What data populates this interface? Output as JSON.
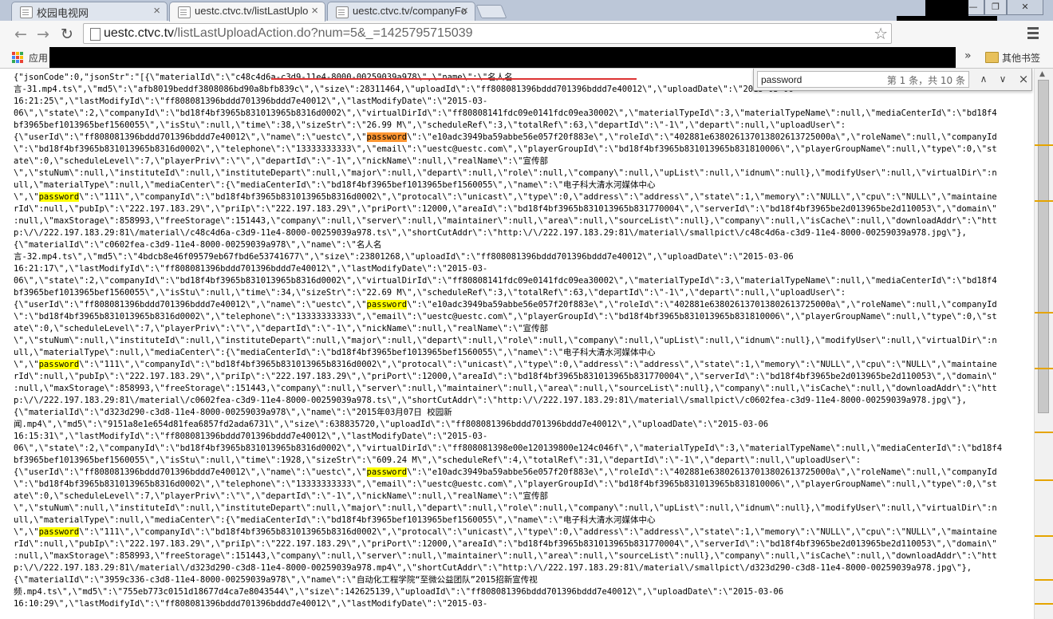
{
  "browser": {
    "tabs": [
      {
        "label": "校园电视网",
        "close": "×"
      },
      {
        "label": "uestc.ctvc.tv/listLastUplo",
        "close": "×"
      },
      {
        "label": "uestc.ctvc.tv/companyFo",
        "close": "×"
      }
    ],
    "window_buttons": {
      "minimize": "—",
      "restore": "❐",
      "close": "✕"
    },
    "nav": {
      "back": "←",
      "forward": "→",
      "reload": "↻"
    },
    "url_host": "uestc.ctvc.tv",
    "url_path": "/listLastUploadAction.do?num=5&_=1425795715039",
    "star": "☆",
    "bookmarks": {
      "apps_label": "应用",
      "chevron": "»",
      "other_label": "其他书签"
    }
  },
  "find": {
    "query": "password",
    "count_text": "第 1 条，共 10 条",
    "prev": "∧",
    "next": "∨",
    "close": "×"
  },
  "content": {
    "lines": [
      [
        "{\"jsonCode\":0,\"jsonStr\":\"[{\\\"materialId\\\":\\\"c48c4d6a-c3d9-11e4-8000-00259039a978\\\",\\\"name\\\":\\\"名人名"
      ],
      [
        "言-31.mp4.ts\\\",\\\"md5\\\":\\\"afb8019beddf3808086bd90a8bfb839c\\\",\\\"size\\\":28311464,\\\"uploadId\\\":\\\"ff808081396bddd701396bddd7e40012\\\",\\\"uploadDate\\\":\\\"2015-03-06"
      ],
      [
        "16:21:25\\\",\\\"lastModifyId\\\":\\\"ff808081396bddd701396bddd7e40012\\\",\\\"lastModifyDate\\\":\\\"2015-03-"
      ],
      [
        "06\\\",\\\"state\\\":2,\\\"companyId\\\":\\\"bd18f4bf3965b831013965b8316d0002\\\",\\\"virtualDirId\\\":\\\"ff80808141fdc09e0141fdc09ea30002\\\",\\\"materialTypeId\\\":3,\\\"materialTypeName\\\":null,\\\"mediaCenterId\\\":\\\"bd18f4"
      ],
      [
        "bf3965bef1013965bef1560055\\\",\\\"isStu\\\":null,\\\"time\\\":38,\\\"sizeStr\\\":\\\"26.99 M\\\",\\\"scheduleRef\\\":3,\\\"totalRef\\\":63,\\\"departId\\\":\\\"-1\\\",\\\"depart\\\":null,\\\"uploadUser\\\":"
      ],
      [
        "{\\\"userId\\\":\\\"ff808081396bddd701396bddd7e40012\\\",\\\"name\\\":\\\"uestc\\\",\\\"",
        {
          "m": "password",
          "cur": true
        },
        "\\\":\\\"e10adc3949ba59abbe56e057f20f883e\\\",\\\"roleId\\\":\\\"402881e638026137013802613725000a\\\",\\\"roleName\\\":null,\\\"companyId"
      ],
      [
        "\\\":\\\"bd18f4bf3965b831013965b8316d0002\\\",\\\"telephone\\\":\\\"13333333333\\\",\\\"email\\\":\\\"uestc@uestc.com\\\",\\\"playerGroupId\\\":\\\"bd18f4bf3965b831013965b831810006\\\",\\\"playerGroupName\\\":null,\\\"type\\\":0,\\\"st"
      ],
      [
        "ate\\\":0,\\\"scheduleLevel\\\":7,\\\"playerPriv\\\":\\\"\\\",\\\"departId\\\":\\\"-1\\\",\\\"nickName\\\":null,\\\"realName\\\":\\\"宣传部"
      ],
      [
        "\\\",\\\"stuNum\\\":null,\\\"instituteId\\\":null,\\\"instituteDepart\\\":null,\\\"major\\\":null,\\\"depart\\\":null,\\\"role\\\":null,\\\"company\\\":null,\\\"upList\\\":null,\\\"idnum\\\":null},\\\"modifyUser\\\":null,\\\"virtualDir\\\":n"
      ],
      [
        "ull,\\\"materialType\\\":null,\\\"mediaCenter\\\":{\\\"mediaCenterId\\\":\\\"bd18f4bf3965bef1013965bef1560055\\\",\\\"name\\\":\\\"电子科大清水河媒体中心"
      ],
      [
        "\\\",\\\"",
        {
          "m": "password"
        },
        "\\\":\\\"111\\\",\\\"companyId\\\":\\\"bd18f4bf3965b831013965b8316d0002\\\",\\\"protocal\\\":\\\"unicast\\\",\\\"type\\\":0,\\\"address\\\":\\\"address\\\",\\\"state\\\":1,\\\"memory\\\":\\\"NULL\\\",\\\"cpu\\\":\\\"NULL\\\",\\\"maintaine"
      ],
      [
        "rId\\\":null,\\\"pubIp\\\":\\\"222.197.183.29\\\",\\\"priIp\\\":\\\"222.197.183.29\\\",\\\"priPort\\\":12000,\\\"areaId\\\":\\\"bd18f4bf3965b831013965b831770004\\\",\\\"serverId\\\":\\\"bd18f4bf3965be2d013965be2d110053\\\",\\\"domain\\\""
      ],
      [
        ":null,\\\"maxStorage\\\":858993,\\\"freeStorage\\\":151443,\\\"company\\\":null,\\\"server\\\":null,\\\"maintainer\\\":null,\\\"area\\\":null,\\\"sourceList\\\":null},\\\"company\\\":null,\\\"isCache\\\":null,\\\"downloadAddr\\\":\\\"htt"
      ],
      [
        "p:\\/\\/222.197.183.29:81\\/material\\/c48c4d6a-c3d9-11e4-8000-00259039a978.ts\\\",\\\"shortCutAddr\\\":\\\"http:\\/\\/222.197.183.29:81\\/material\\/smallpict\\/c48c4d6a-c3d9-11e4-8000-00259039a978.jpg\\\"},"
      ],
      [
        "{\\\"materialId\\\":\\\"c0602fea-c3d9-11e4-8000-00259039a978\\\",\\\"name\\\":\\\"名人名"
      ],
      [
        "言-32.mp4.ts\\\",\\\"md5\\\":\\\"4bdcb8e46f09579eb67fbd6e53741677\\\",\\\"size\\\":23801268,\\\"uploadId\\\":\\\"ff808081396bddd701396bddd7e40012\\\",\\\"uploadDate\\\":\\\"2015-03-06"
      ],
      [
        "16:21:17\\\",\\\"lastModifyId\\\":\\\"ff808081396bddd701396bddd7e40012\\\",\\\"lastModifyDate\\\":\\\"2015-03-"
      ],
      [
        "06\\\",\\\"state\\\":2,\\\"companyId\\\":\\\"bd18f4bf3965b831013965b8316d0002\\\",\\\"virtualDirId\\\":\\\"ff80808141fdc09e0141fdc09ea30002\\\",\\\"materialTypeId\\\":3,\\\"materialTypeName\\\":null,\\\"mediaCenterId\\\":\\\"bd18f4"
      ],
      [
        "bf3965bef1013965bef1560055\\\",\\\"isStu\\\":null,\\\"time\\\":34,\\\"sizeStr\\\":\\\"22.69 M\\\",\\\"scheduleRef\\\":3,\\\"totalRef\\\":63,\\\"departId\\\":\\\"-1\\\",\\\"depart\\\":null,\\\"uploadUser\\\":"
      ],
      [
        "{\\\"userId\\\":\\\"ff808081396bddd701396bddd7e40012\\\",\\\"name\\\":\\\"uestc\\\",\\\"",
        {
          "m": "password"
        },
        "\\\":\\\"e10adc3949ba59abbe56e057f20f883e\\\",\\\"roleId\\\":\\\"402881e638026137013802613725000a\\\",\\\"roleName\\\":null,\\\"companyId"
      ],
      [
        "\\\":\\\"bd18f4bf3965b831013965b8316d0002\\\",\\\"telephone\\\":\\\"13333333333\\\",\\\"email\\\":\\\"uestc@uestc.com\\\",\\\"playerGroupId\\\":\\\"bd18f4bf3965b831013965b831810006\\\",\\\"playerGroupName\\\":null,\\\"type\\\":0,\\\"st"
      ],
      [
        "ate\\\":0,\\\"scheduleLevel\\\":7,\\\"playerPriv\\\":\\\"\\\",\\\"departId\\\":\\\"-1\\\",\\\"nickName\\\":null,\\\"realName\\\":\\\"宣传部"
      ],
      [
        "\\\",\\\"stuNum\\\":null,\\\"instituteId\\\":null,\\\"instituteDepart\\\":null,\\\"major\\\":null,\\\"depart\\\":null,\\\"role\\\":null,\\\"company\\\":null,\\\"upList\\\":null,\\\"idnum\\\":null},\\\"modifyUser\\\":null,\\\"virtualDir\\\":n"
      ],
      [
        "ull,\\\"materialType\\\":null,\\\"mediaCenter\\\":{\\\"mediaCenterId\\\":\\\"bd18f4bf3965bef1013965bef1560055\\\",\\\"name\\\":\\\"电子科大清水河媒体中心"
      ],
      [
        "\\\",\\\"",
        {
          "m": "password"
        },
        "\\\":\\\"111\\\",\\\"companyId\\\":\\\"bd18f4bf3965b831013965b8316d0002\\\",\\\"protocal\\\":\\\"unicast\\\",\\\"type\\\":0,\\\"address\\\":\\\"address\\\",\\\"state\\\":1,\\\"memory\\\":\\\"NULL\\\",\\\"cpu\\\":\\\"NULL\\\",\\\"maintaine"
      ],
      [
        "rId\\\":null,\\\"pubIp\\\":\\\"222.197.183.29\\\",\\\"priIp\\\":\\\"222.197.183.29\\\",\\\"priPort\\\":12000,\\\"areaId\\\":\\\"bd18f4bf3965b831013965b831770004\\\",\\\"serverId\\\":\\\"bd18f4bf3965be2d013965be2d110053\\\",\\\"domain\\\""
      ],
      [
        ":null,\\\"maxStorage\\\":858993,\\\"freeStorage\\\":151443,\\\"company\\\":null,\\\"server\\\":null,\\\"maintainer\\\":null,\\\"area\\\":null,\\\"sourceList\\\":null},\\\"company\\\":null,\\\"isCache\\\":null,\\\"downloadAddr\\\":\\\"htt"
      ],
      [
        "p:\\/\\/222.197.183.29:81\\/material\\/c0602fea-c3d9-11e4-8000-00259039a978.ts\\\",\\\"shortCutAddr\\\":\\\"http:\\/\\/222.197.183.29:81\\/material\\/smallpict\\/c0602fea-c3d9-11e4-8000-00259039a978.jpg\\\"},"
      ],
      [
        "{\\\"materialId\\\":\\\"d323d290-c3d8-11e4-8000-00259039a978\\\",\\\"name\\\":\\\"2015年03月07日 校园新"
      ],
      [
        "闻.mp4\\\",\\\"md5\\\":\\\"9151a8e1e654d81fea6857fd2ada6731\\\",\\\"size\\\":638835720,\\\"uploadId\\\":\\\"ff808081396bddd701396bddd7e40012\\\",\\\"uploadDate\\\":\\\"2015-03-06"
      ],
      [
        "16:15:31\\\",\\\"lastModifyId\\\":\\\"ff808081396bddd701396bddd7e40012\\\",\\\"lastModifyDate\\\":\\\"2015-03-"
      ],
      [
        "06\\\",\\\"state\\\":2,\\\"companyId\\\":\\\"bd18f4bf3965b831013965b8316d0002\\\",\\\"virtualDirId\\\":\\\"ff808081398e00e120139800e124c046f\\\",\\\"materialTypeId\\\":3,\\\"materialTypeName\\\":null,\\\"mediaCenterId\\\":\\\"bd18f4"
      ],
      [
        "bf3965bef1013965bef1560055\\\",\\\"isStu\\\":null,\\\"time\\\":1928,\\\"sizeStr\\\":\\\"609.24 M\\\",\\\"scheduleRef\\\":4,\\\"totalRef\\\":31,\\\"departId\\\":\\\"-1\\\",\\\"depart\\\":null,\\\"uploadUser\\\":"
      ],
      [
        "{\\\"userId\\\":\\\"ff808081396bddd701396bddd7e40012\\\",\\\"name\\\":\\\"uestc\\\",\\\"",
        {
          "m": "password"
        },
        "\\\":\\\"e10adc3949ba59abbe56e057f20f883e\\\",\\\"roleId\\\":\\\"402881e638026137013802613725000a\\\",\\\"roleName\\\":null,\\\"companyId"
      ],
      [
        "\\\":\\\"bd18f4bf3965b831013965b8316d0002\\\",\\\"telephone\\\":\\\"13333333333\\\",\\\"email\\\":\\\"uestc@uestc.com\\\",\\\"playerGroupId\\\":\\\"bd18f4bf3965b831013965b831810006\\\",\\\"playerGroupName\\\":null,\\\"type\\\":0,\\\"st"
      ],
      [
        "ate\\\":0,\\\"scheduleLevel\\\":7,\\\"playerPriv\\\":\\\"\\\",\\\"departId\\\":\\\"-1\\\",\\\"nickName\\\":null,\\\"realName\\\":\\\"宣传部"
      ],
      [
        "\\\",\\\"stuNum\\\":null,\\\"instituteId\\\":null,\\\"instituteDepart\\\":null,\\\"major\\\":null,\\\"depart\\\":null,\\\"role\\\":null,\\\"company\\\":null,\\\"upList\\\":null,\\\"idnum\\\":null},\\\"modifyUser\\\":null,\\\"virtualDir\\\":n"
      ],
      [
        "ull,\\\"materialType\\\":null,\\\"mediaCenter\\\":{\\\"mediaCenterId\\\":\\\"bd18f4bf3965bef1013965bef1560055\\\",\\\"name\\\":\\\"电子科大清水河媒体中心"
      ],
      [
        "\\\",\\\"",
        {
          "m": "password"
        },
        "\\\":\\\"111\\\",\\\"companyId\\\":\\\"bd18f4bf3965b831013965b8316d0002\\\",\\\"protocal\\\":\\\"unicast\\\",\\\"type\\\":0,\\\"address\\\":\\\"address\\\",\\\"state\\\":1,\\\"memory\\\":\\\"NULL\\\",\\\"cpu\\\":\\\"NULL\\\",\\\"maintaine"
      ],
      [
        "rId\\\":null,\\\"pubIp\\\":\\\"222.197.183.29\\\",\\\"priIp\\\":\\\"222.197.183.29\\\",\\\"priPort\\\":12000,\\\"areaId\\\":\\\"bd18f4bf3965b831013965b831770004\\\",\\\"serverId\\\":\\\"bd18f4bf3965be2d013965be2d110053\\\",\\\"domain\\\""
      ],
      [
        ":null,\\\"maxStorage\\\":858993,\\\"freeStorage\\\":151443,\\\"company\\\":null,\\\"server\\\":null,\\\"maintainer\\\":null,\\\"area\\\":null,\\\"sourceList\\\":null},\\\"company\\\":null,\\\"isCache\\\":null,\\\"downloadAddr\\\":\\\"htt"
      ],
      [
        "p:\\/\\/222.197.183.29:81\\/material\\/d323d290-c3d8-11e4-8000-00259039a978.mp4\\\",\\\"shortCutAddr\\\":\\\"http:\\/\\/222.197.183.29:81\\/material\\/smallpict\\/d323d290-c3d8-11e4-8000-00259039a978.jpg\\\"},"
      ],
      [
        "{\\\"materialId\\\":\\\"3959c336-c3d8-11e4-8000-00259039a978\\\",\\\"name\\\":\\\"自动化工程学院“至微公益团队”2015招新宣传视"
      ],
      [
        "频.mp4.ts\\\",\\\"md5\\\":\\\"755eb773c0151d18677d4ca7e8043544\\\",\\\"size\\\":142625139,\\\"uploadId\\\":\\\"ff808081396bddd701396bddd7e40012\\\",\\\"uploadDate\\\":\\\"2015-03-06"
      ],
      [
        "16:10:29\\\",\\\"lastModifyId\\\":\\\"ff808081396bddd701396bddd7e40012\\\",\\\"lastModifyDate\\\":\\\"2015-03-"
      ]
    ]
  }
}
